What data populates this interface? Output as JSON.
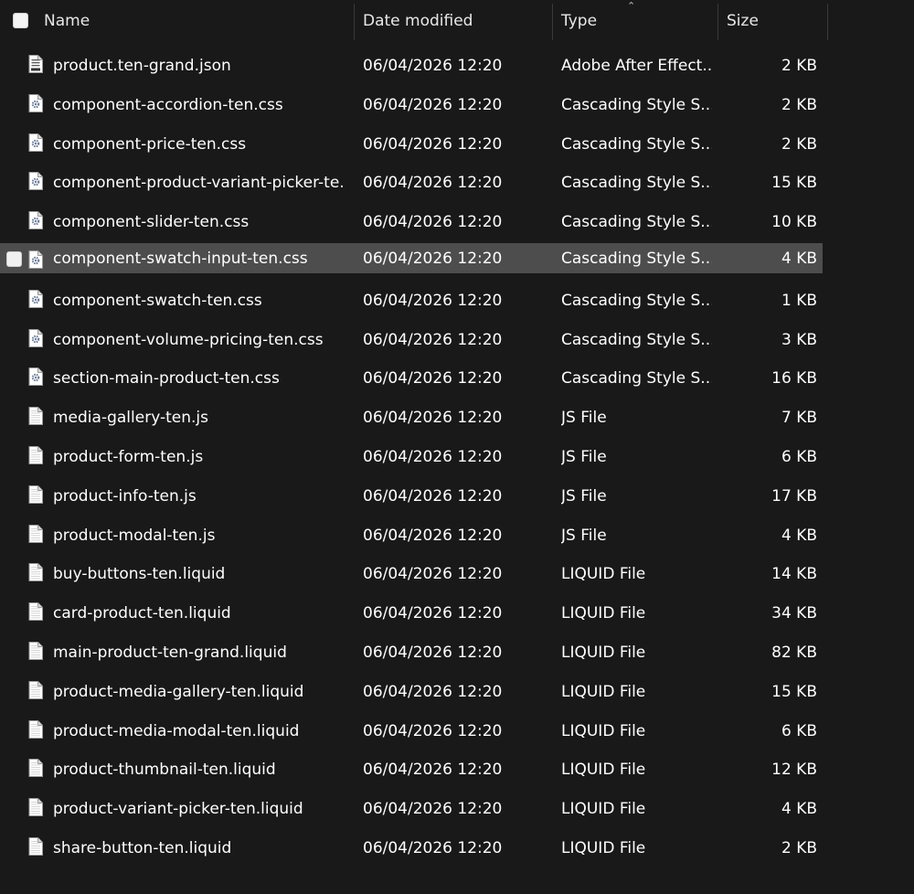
{
  "header": {
    "name": "Name",
    "date_modified": "Date modified",
    "type": "Type",
    "size": "Size"
  },
  "files": [
    {
      "name": "product.ten-grand.json",
      "date": "06/04/2026 12:20",
      "type": "Adobe After Effect...",
      "size": "2 KB",
      "icon": "json-file-icon"
    },
    {
      "name": "component-accordion-ten.css",
      "date": "06/04/2026 12:20",
      "type": "Cascading Style S...",
      "size": "2 KB",
      "icon": "css-file-icon"
    },
    {
      "name": "component-price-ten.css",
      "date": "06/04/2026 12:20",
      "type": "Cascading Style S...",
      "size": "2 KB",
      "icon": "css-file-icon"
    },
    {
      "name": "component-product-variant-picker-te...",
      "date": "06/04/2026 12:20",
      "type": "Cascading Style S...",
      "size": "15 KB",
      "icon": "css-file-icon"
    },
    {
      "name": "component-slider-ten.css",
      "date": "06/04/2026 12:20",
      "type": "Cascading Style S...",
      "size": "10 KB",
      "icon": "css-file-icon"
    },
    {
      "name": "component-swatch-input-ten.css",
      "date": "06/04/2026 12:20",
      "type": "Cascading Style S...",
      "size": "4 KB",
      "icon": "css-file-icon",
      "selected": true
    },
    {
      "name": "component-swatch-ten.css",
      "date": "06/04/2026 12:20",
      "type": "Cascading Style S...",
      "size": "1 KB",
      "icon": "css-file-icon"
    },
    {
      "name": "component-volume-pricing-ten.css",
      "date": "06/04/2026 12:20",
      "type": "Cascading Style S...",
      "size": "3 KB",
      "icon": "css-file-icon"
    },
    {
      "name": "section-main-product-ten.css",
      "date": "06/04/2026 12:20",
      "type": "Cascading Style S...",
      "size": "16 KB",
      "icon": "css-file-icon"
    },
    {
      "name": "media-gallery-ten.js",
      "date": "06/04/2026 12:20",
      "type": "JS File",
      "size": "7 KB",
      "icon": "file-icon"
    },
    {
      "name": "product-form-ten.js",
      "date": "06/04/2026 12:20",
      "type": "JS File",
      "size": "6 KB",
      "icon": "file-icon"
    },
    {
      "name": "product-info-ten.js",
      "date": "06/04/2026 12:20",
      "type": "JS File",
      "size": "17 KB",
      "icon": "file-icon"
    },
    {
      "name": "product-modal-ten.js",
      "date": "06/04/2026 12:20",
      "type": "JS File",
      "size": "4 KB",
      "icon": "file-icon"
    },
    {
      "name": "buy-buttons-ten.liquid",
      "date": "06/04/2026 12:20",
      "type": "LIQUID File",
      "size": "14 KB",
      "icon": "file-icon"
    },
    {
      "name": "card-product-ten.liquid",
      "date": "06/04/2026 12:20",
      "type": "LIQUID File",
      "size": "34 KB",
      "icon": "file-icon"
    },
    {
      "name": "main-product-ten-grand.liquid",
      "date": "06/04/2026 12:20",
      "type": "LIQUID File",
      "size": "82 KB",
      "icon": "file-icon"
    },
    {
      "name": "product-media-gallery-ten.liquid",
      "date": "06/04/2026 12:20",
      "type": "LIQUID File",
      "size": "15 KB",
      "icon": "file-icon"
    },
    {
      "name": "product-media-modal-ten.liquid",
      "date": "06/04/2026 12:20",
      "type": "LIQUID File",
      "size": "6 KB",
      "icon": "file-icon"
    },
    {
      "name": "product-thumbnail-ten.liquid",
      "date": "06/04/2026 12:20",
      "type": "LIQUID File",
      "size": "12 KB",
      "icon": "file-icon"
    },
    {
      "name": "product-variant-picker-ten.liquid",
      "date": "06/04/2026 12:20",
      "type": "LIQUID File",
      "size": "4 KB",
      "icon": "file-icon"
    },
    {
      "name": "share-button-ten.liquid",
      "date": "06/04/2026 12:20",
      "type": "LIQUID File",
      "size": "2 KB",
      "icon": "file-icon"
    }
  ]
}
